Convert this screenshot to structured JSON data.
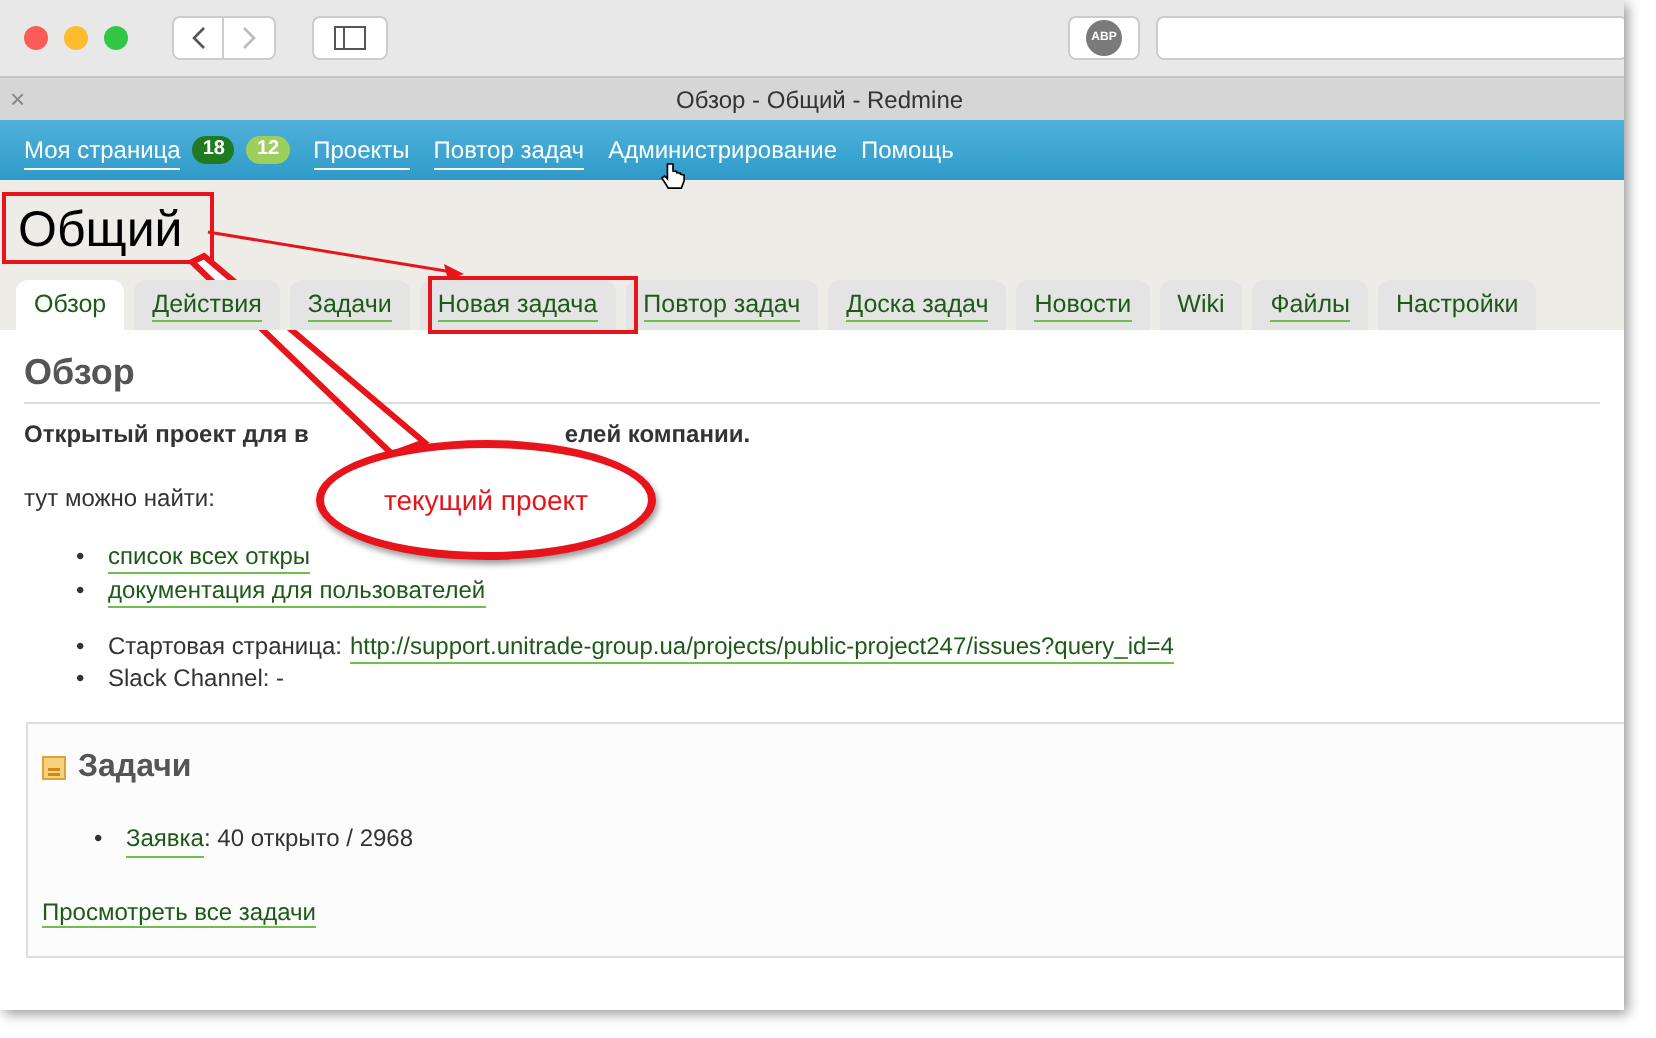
{
  "browser": {
    "adblock_label": "ABP",
    "tab_close": "×",
    "tab_title": "Обзор - Общий - Redmine"
  },
  "top_menu": [
    {
      "label": "Моя страница",
      "underlined": true,
      "badges": [
        {
          "text": "18",
          "color": "#1f7a22"
        },
        {
          "text": "12",
          "color": "#9ccf5c"
        }
      ]
    },
    {
      "label": "Проекты",
      "underlined": true
    },
    {
      "label": "Повтор задач",
      "underlined": true
    },
    {
      "label": "Администрирование",
      "underlined": false
    },
    {
      "label": "Помощь",
      "underlined": false
    }
  ],
  "project_title": "Общий",
  "tabs": [
    {
      "label": "Обзор",
      "selected": true,
      "underlined": false
    },
    {
      "label": "Действия",
      "selected": false,
      "underlined": true
    },
    {
      "label": "Задачи",
      "selected": false,
      "underlined": true
    },
    {
      "label": "Новая задача",
      "selected": false,
      "underlined": true
    },
    {
      "label": "Повтор задач",
      "selected": false,
      "underlined": true
    },
    {
      "label": "Доска задач",
      "selected": false,
      "underlined": true
    },
    {
      "label": "Новости",
      "selected": false,
      "underlined": true
    },
    {
      "label": "Wiki",
      "selected": false,
      "underlined": false
    },
    {
      "label": "Файлы",
      "selected": false,
      "underlined": true
    },
    {
      "label": "Настройки",
      "selected": false,
      "underlined": false
    }
  ],
  "content": {
    "heading": "Обзор",
    "description_start": "Открытый проект для в",
    "description_end": "елей компании.",
    "intro": "тут можно найти:",
    "links": [
      {
        "marker": "•",
        "text": "список всех откры"
      },
      {
        "marker": "•",
        "text": "документация для пользователей"
      }
    ],
    "info": [
      {
        "marker": "•",
        "kind": "link",
        "label": "Стартовая страница:",
        "value": "http://support.unitrade-group.ua/projects/public-project247/issues?query_id=4"
      },
      {
        "marker": "•",
        "kind": "text",
        "text": "Slack Channel: -"
      }
    ]
  },
  "issues_panel": {
    "title": "Задачи",
    "items": [
      {
        "marker": "•",
        "link": "Заявка",
        "text": ": 40 открыто / 2968"
      }
    ],
    "footer_link": "Просмотреть все задачи"
  },
  "annotation": {
    "callout": "текущий проект"
  }
}
